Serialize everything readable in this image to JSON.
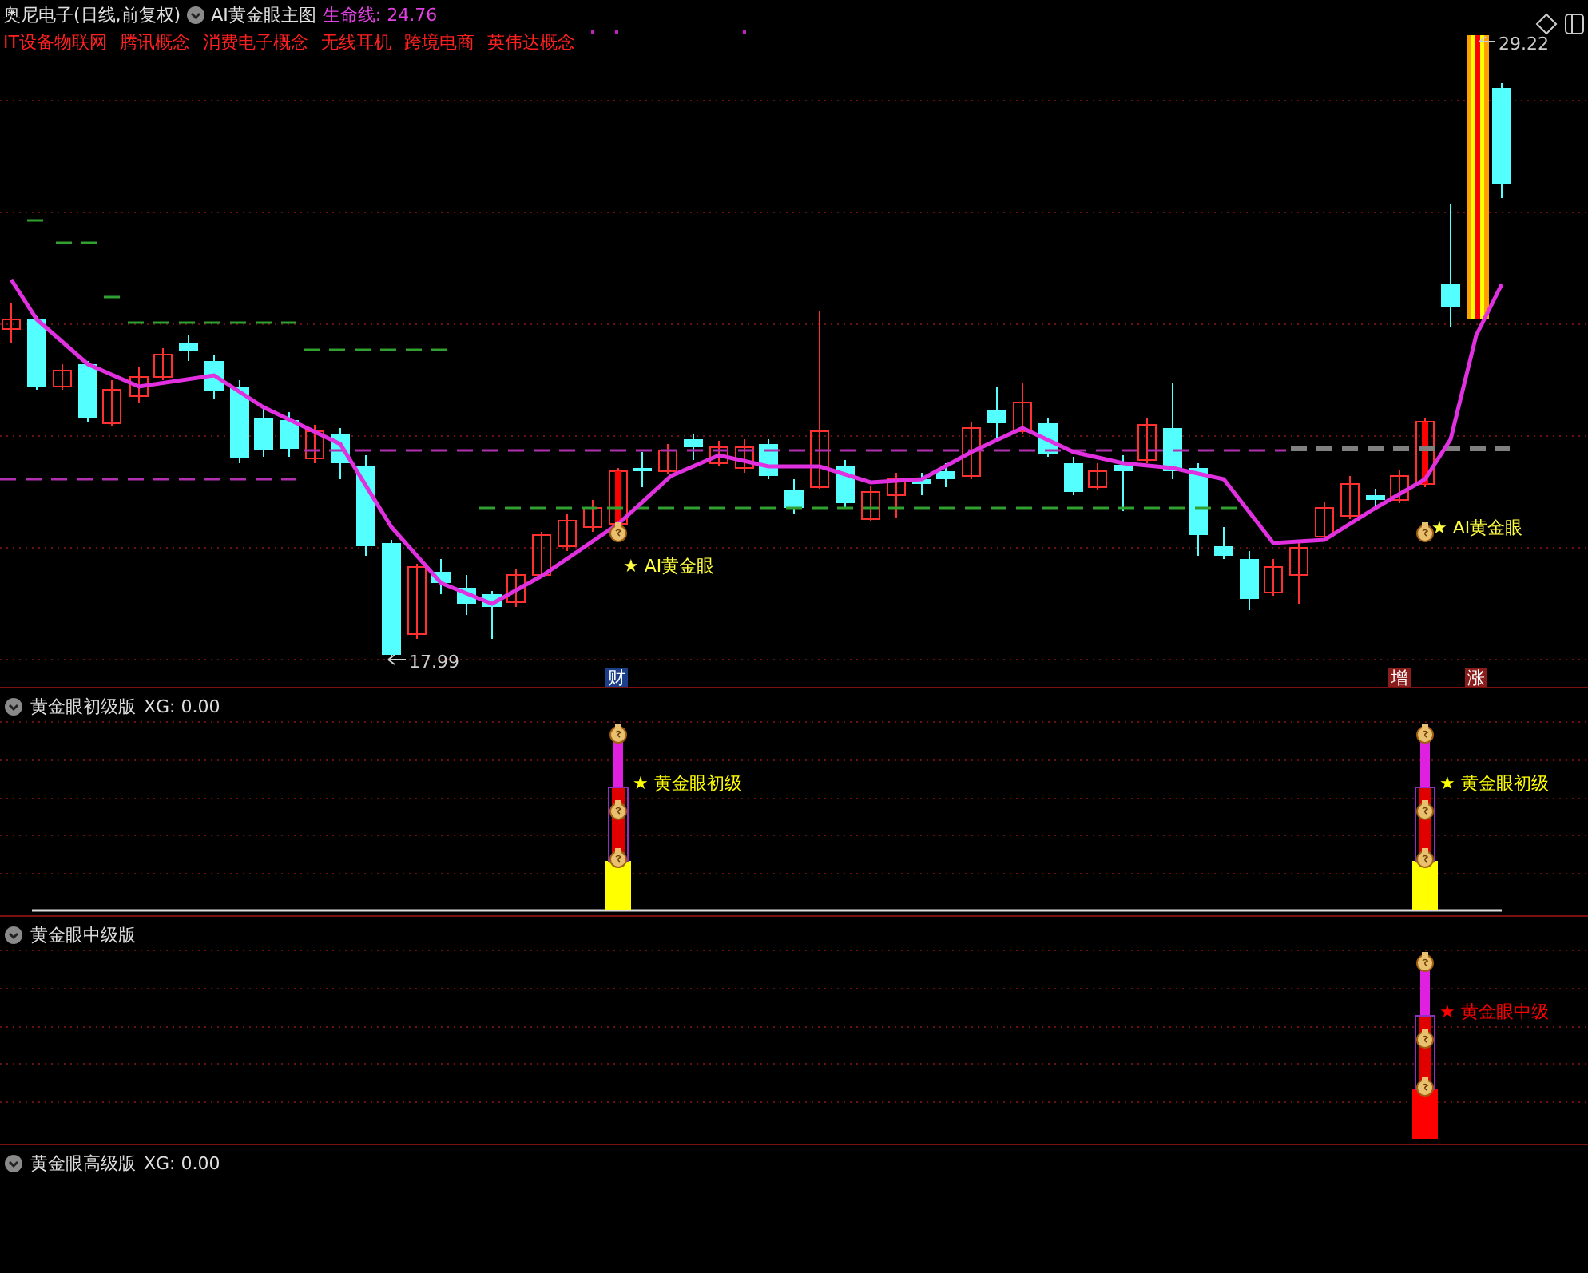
{
  "header": {
    "stock": "奥尼电子(日线,前复权)",
    "indicator": "AI黄金眼主图",
    "life_line": "生命线: 24.76"
  },
  "concepts": [
    "IT设备物联网",
    "腾讯概念",
    "消费电子概念",
    "无线耳机",
    "跨境电商",
    "英伟达概念"
  ],
  "main_chart": {
    "low_label": "17.99",
    "high_label": "29.22",
    "signals": [
      "★ AI黄金眼",
      "★ AI黄金眼"
    ],
    "tags": [
      {
        "text": "财",
        "color": "#1c3f8a"
      },
      {
        "text": "增",
        "color": "#8a1c1c"
      },
      {
        "text": "涨",
        "color": "#8a1c1c"
      }
    ]
  },
  "panels": [
    {
      "title": "黄金眼初级版",
      "reading": "XG: 0.00",
      "color": "#ffff00",
      "signals": [
        "★ 黄金眼初级",
        "★ 黄金眼初级"
      ]
    },
    {
      "title": "黄金眼中级版",
      "color": "#ff0000",
      "signals": [
        "★ 黄金眼中级"
      ]
    },
    {
      "title": "黄金眼高级版",
      "reading": "XG: 0.00"
    }
  ]
}
